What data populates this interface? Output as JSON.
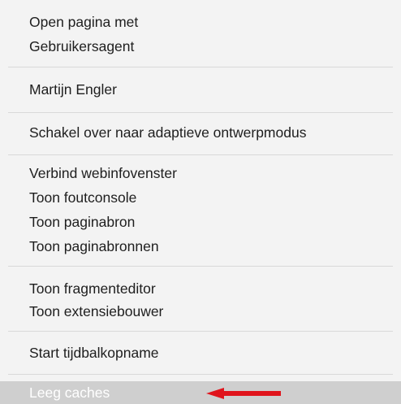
{
  "menu": {
    "items": [
      {
        "label": "Open pagina met"
      },
      {
        "label": "Gebruikersagent"
      },
      {
        "label": "Martijn Engler"
      },
      {
        "label": "Schakel over naar adaptieve ontwerpmodus"
      },
      {
        "label": "Verbind webinfovenster"
      },
      {
        "label": "Toon foutconsole"
      },
      {
        "label": "Toon paginabron"
      },
      {
        "label": "Toon paginabronnen"
      },
      {
        "label": "Toon fragmenteditor"
      },
      {
        "label": "Toon extensiebouwer"
      },
      {
        "label": "Start tijdbalkopname"
      },
      {
        "label": "Leeg caches"
      }
    ],
    "highlight_color": "#cfcfcf",
    "annotation_arrow_color": "#e0141c"
  }
}
